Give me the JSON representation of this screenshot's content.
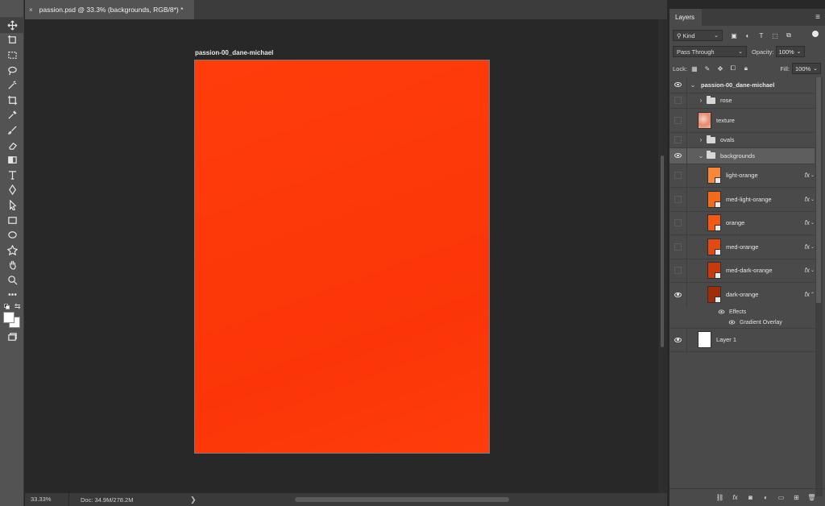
{
  "tab": {
    "close": "×",
    "title": "passion.psd @ 33.3% (backgrounds, RGB/8*) *"
  },
  "artboard": {
    "label": "passion-00_dane-michael",
    "fill_top": "#ff3d0b",
    "fill_bottom": "#fb3507"
  },
  "status": {
    "zoom": "33.33%",
    "doc": "Doc: 34.9M/278.2M",
    "arrow": "❯"
  },
  "panel": {
    "tab_label": "Layers",
    "kind_filter": "Kind",
    "blend_mode": "Pass Through",
    "opacity_label": "Opacity:",
    "opacity_value": "100%",
    "lock_label": "Lock:",
    "fill_label": "Fill:",
    "fill_value": "100%",
    "layers": [
      {
        "name": "passion-00_dane-michael",
        "type": "artboard",
        "visible": true
      },
      {
        "name": "rose",
        "type": "group",
        "visible": false
      },
      {
        "name": "texture",
        "type": "image",
        "visible": false
      },
      {
        "name": "ovals",
        "type": "group",
        "visible": false
      },
      {
        "name": "backgrounds",
        "type": "group",
        "visible": true,
        "selected": true
      },
      {
        "name": "light-orange",
        "type": "shape",
        "color": "#f7883a",
        "visible": false,
        "fx": "fx"
      },
      {
        "name": "med-light-orange",
        "type": "shape",
        "color": "#f36a1c",
        "visible": false,
        "fx": "fx"
      },
      {
        "name": "orange",
        "type": "shape",
        "color": "#f25a13",
        "visible": false,
        "fx": "fx"
      },
      {
        "name": "med-orange",
        "type": "shape",
        "color": "#e34a10",
        "visible": false,
        "fx": "fx"
      },
      {
        "name": "med-dark-orange",
        "type": "shape",
        "color": "#c83a0c",
        "visible": false,
        "fx": "fx"
      },
      {
        "name": "dark-orange",
        "type": "shape",
        "color": "#a12d08",
        "visible": true,
        "fx": "fx"
      },
      {
        "name": "Layer 1",
        "type": "image",
        "color": "#ffffff",
        "visible": true
      }
    ],
    "effects_label": "Effects",
    "gradient_overlay_label": "Gradient Overlay"
  }
}
